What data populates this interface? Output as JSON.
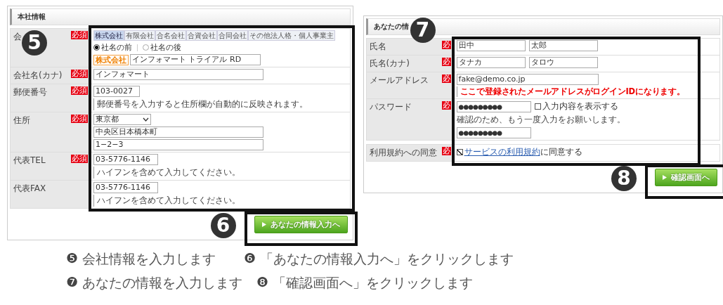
{
  "company_form": {
    "title": "本社情報",
    "marker": "5",
    "button_marker": "6",
    "button": "あなたの情報入力へ",
    "rows": [
      {
        "label": "会",
        "required": "必須",
        "lines": [
          [
            {
              "kind": "tabs",
              "tabs": [
                {
                  "label": "株式会社",
                  "selected": true
                },
                {
                  "label": "有限会社",
                  "selected": false
                },
                {
                  "label": "合名会社",
                  "selected": false
                },
                {
                  "label": "合資会社",
                  "selected": false
                },
                {
                  "label": "合同会社",
                  "selected": false
                },
                {
                  "label": "その他法人格・個人事業主",
                  "selected": false
                }
              ]
            }
          ],
          [
            {
              "kind": "radios",
              "options": [
                {
                  "label": "社名の前",
                  "selected": true
                },
                {
                  "label": "社名の後",
                  "selected": false
                }
              ]
            }
          ],
          [
            {
              "kind": "prefixed_field",
              "prefix": "株式会社",
              "value": "インフォマート トライアル RD"
            }
          ]
        ]
      },
      {
        "label": "会社名(カナ)",
        "required": "必須",
        "lines": [
          [
            {
              "kind": "field_long",
              "value": "インフォマート"
            }
          ]
        ]
      },
      {
        "label": "郵便番号",
        "required": "必須",
        "lines": [
          [
            {
              "kind": "field_short",
              "value": "103-0027"
            }
          ],
          [
            {
              "kind": "note",
              "text": "郵便番号を入力すると住所欄が自動的に反映されます。"
            }
          ]
        ]
      },
      {
        "label": "住所",
        "required": "必須",
        "lines": [
          [
            {
              "kind": "select",
              "value": "東京都"
            }
          ],
          [
            {
              "kind": "field_long",
              "value": "中央区日本橋本町"
            }
          ],
          [
            {
              "kind": "field_long",
              "value": "1−2−3"
            }
          ]
        ]
      },
      {
        "label": "代表TEL",
        "required": "必須",
        "lines": [
          [
            {
              "kind": "field_medium",
              "value": "03-5776-1146"
            }
          ],
          [
            {
              "kind": "note",
              "text": "ハイフンを含めて入力してください。"
            }
          ]
        ]
      },
      {
        "label": "代表FAX",
        "lines": [
          [
            {
              "kind": "field_medium",
              "value": "03-5776-1146"
            }
          ],
          [
            {
              "kind": "note",
              "text": "ハイフンを含めて入力してください。"
            }
          ]
        ]
      }
    ]
  },
  "personal_form": {
    "title": "あなたの情",
    "marker": "7",
    "button_marker": "8",
    "button": "確認画面へ",
    "rows": [
      {
        "label": "氏名",
        "required": "必",
        "lines": [
          [
            {
              "kind": "field_half",
              "value": "田中"
            },
            {
              "kind": "field_half",
              "value": "太郎"
            }
          ]
        ]
      },
      {
        "label": "氏名(カナ)",
        "required": "必",
        "lines": [
          [
            {
              "kind": "field_half",
              "value": "タナカ"
            },
            {
              "kind": "field_half",
              "value": "タロウ"
            }
          ]
        ]
      },
      {
        "label": "メールアドレス",
        "required": "必",
        "lines": [
          [
            {
              "kind": "field_wide",
              "value": "fake@demo.co.jp"
            }
          ],
          [
            {
              "kind": "warning",
              "text": "ここで登録されたメールアドレスがログインIDになります。"
            }
          ]
        ]
      },
      {
        "label": "パスワード",
        "required": "必",
        "lines": [
          [
            {
              "kind": "password",
              "value": "●●●●●●●●●"
            },
            {
              "kind": "checkbox",
              "label": "入力内容を表示する",
              "checked": false
            }
          ],
          [
            {
              "kind": "plain",
              "text": "確認のため、もう一度入力をお願いします。"
            }
          ],
          [
            {
              "kind": "password",
              "value": "●●●●●●●●●"
            }
          ]
        ]
      }
    ],
    "consent_rows": [
      {
        "label": "利用規約への同意",
        "required": "必",
        "lines": [
          [
            {
              "kind": "agree",
              "checked": true,
              "link": "サービスの利用規約",
              "text": "に同意する"
            }
          ]
        ]
      }
    ]
  },
  "captions": [
    [
      {
        "number": "❺",
        "text": "会社情報を入力します"
      },
      {
        "number": "❻",
        "text": "「あなたの情報入力へ」をクリックします"
      }
    ],
    [
      {
        "number": "❼",
        "text": "あなたの情報を入力します"
      },
      {
        "number": "❽",
        "text": "「確認画面へ」をクリックします"
      }
    ]
  ]
}
